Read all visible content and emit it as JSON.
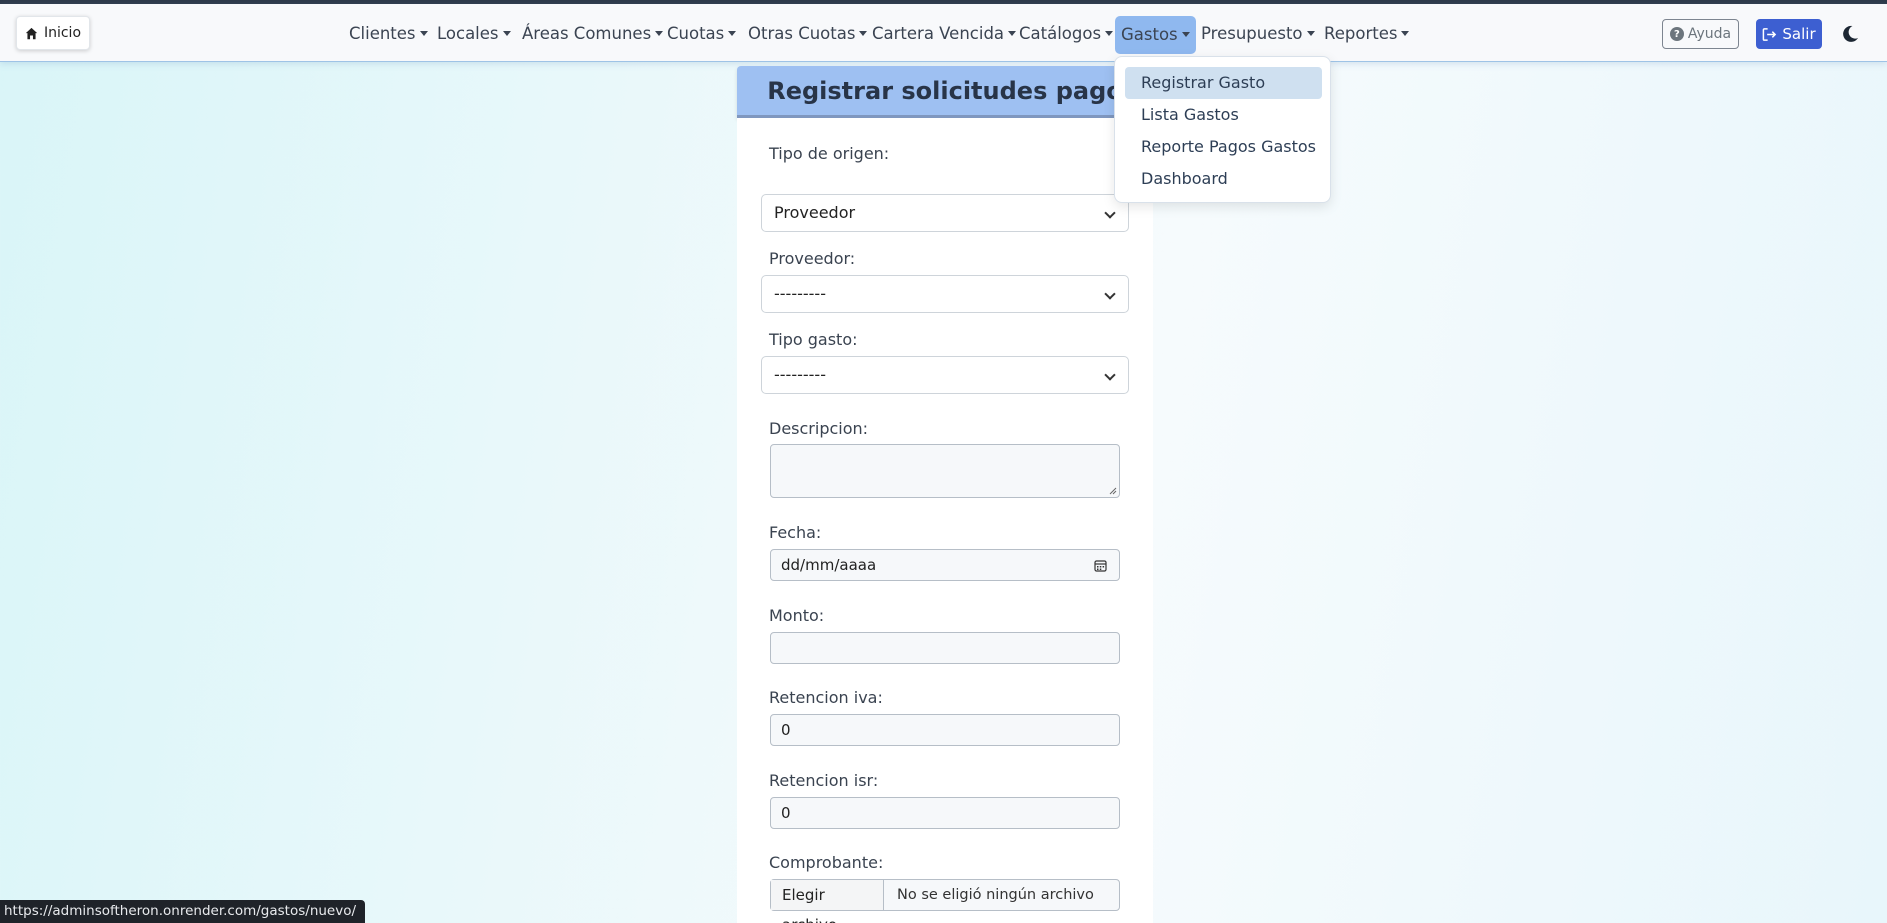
{
  "navbar": {
    "home_label": "Inicio",
    "menus": [
      "Clientes",
      "Locales",
      "Áreas Comunes",
      "Cuotas",
      "Otras Cuotas",
      "Cartera Vencida",
      "Catálogos",
      "Gastos",
      "Presupuesto",
      "Reportes"
    ],
    "active_menu": "Gastos",
    "help_label": "Ayuda",
    "logout_label": "Salir"
  },
  "dropdown": {
    "items": [
      "Registrar Gasto",
      "Lista Gastos",
      "Reporte Pagos Gastos",
      "Dashboard"
    ],
    "selected": "Registrar Gasto"
  },
  "form": {
    "title": "Registrar solicitudes pago",
    "tipo_origen_label": "Tipo de origen:",
    "tipo_origen_value": "Proveedor",
    "proveedor_label": "Proveedor:",
    "proveedor_value": "---------",
    "tipo_gasto_label": "Tipo gasto:",
    "tipo_gasto_value": "---------",
    "descripcion_label": "Descripcion:",
    "fecha_label": "Fecha:",
    "fecha_placeholder": "dd/mm/aaaa",
    "monto_label": "Monto:",
    "monto_value": "",
    "retencion_iva_label": "Retencion iva:",
    "retencion_iva_value": "0",
    "retencion_isr_label": "Retencion isr:",
    "retencion_isr_value": "0",
    "comprobante_label": "Comprobante:",
    "file_button_label": "Elegir archivo",
    "file_status": "No se eligió ningún archivo"
  },
  "status_url": "https://adminsoftheron.onrender.com/gastos/nuevo/",
  "colors": {
    "active_menu_bg": "#8fb8ef",
    "salir_bg": "#3d5fd1",
    "title_bg": "#9ec0f2",
    "selected_item_bg": "#cfe0f0"
  }
}
